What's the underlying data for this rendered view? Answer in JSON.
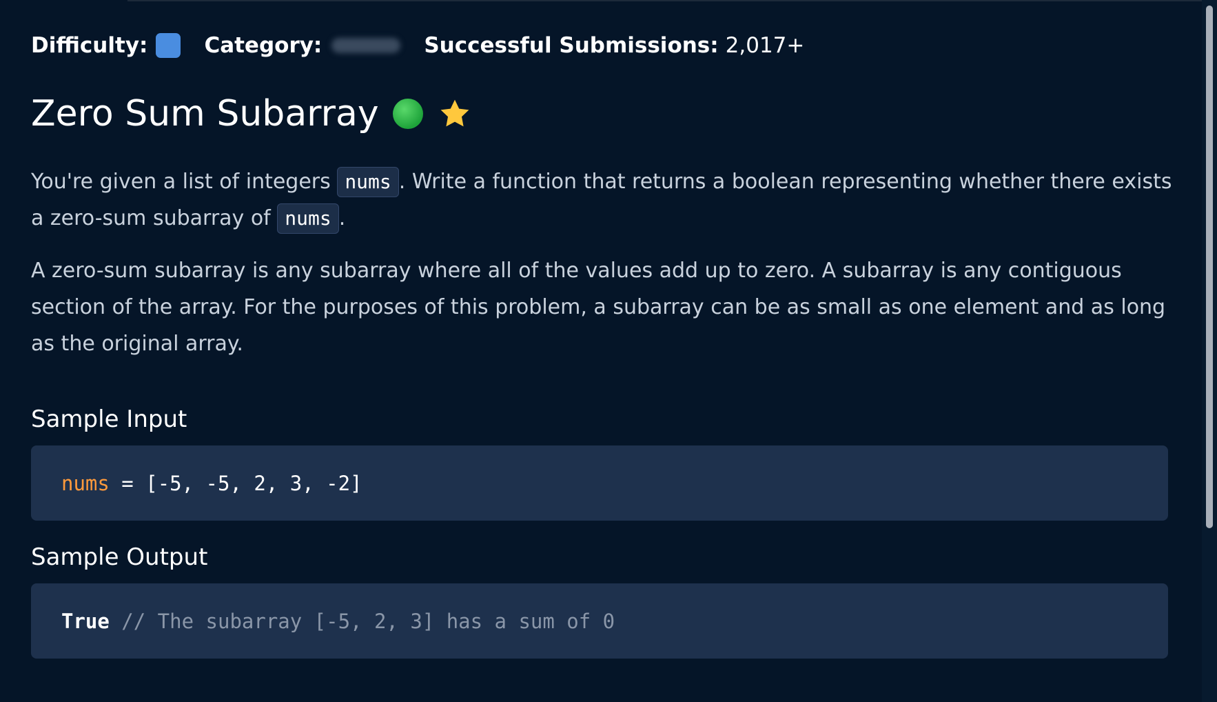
{
  "meta": {
    "difficulty_label": "Difficulty:",
    "difficulty_color": "#4a8de0",
    "category_label": "Category:",
    "submissions_label": "Successful Submissions:",
    "submissions_value": "2,017+"
  },
  "problem": {
    "title": "Zero Sum Subarray",
    "status_color": "#2fb84a",
    "star_icon": "star-icon",
    "p1_before": "You're given a list of integers ",
    "p1_code1": "nums",
    "p1_middle": ". Write a function that returns a boolean representing whether there exists a zero-sum subarray of ",
    "p1_code2": "nums",
    "p1_end": ".",
    "p2": "A zero-sum subarray is any subarray where all of the values add up to zero. A subarray is any contiguous section of the array. For the purposes of this problem, a subarray can be as small as one element and as long as the original array."
  },
  "sample_input": {
    "heading": "Sample Input",
    "var": "nums",
    "op": " = ",
    "value": "[-5, -5, 2, 3, -2]"
  },
  "sample_output": {
    "heading": "Sample Output",
    "value": "True",
    "comment": " // The subarray [-5, 2, 3] has a sum of 0"
  }
}
